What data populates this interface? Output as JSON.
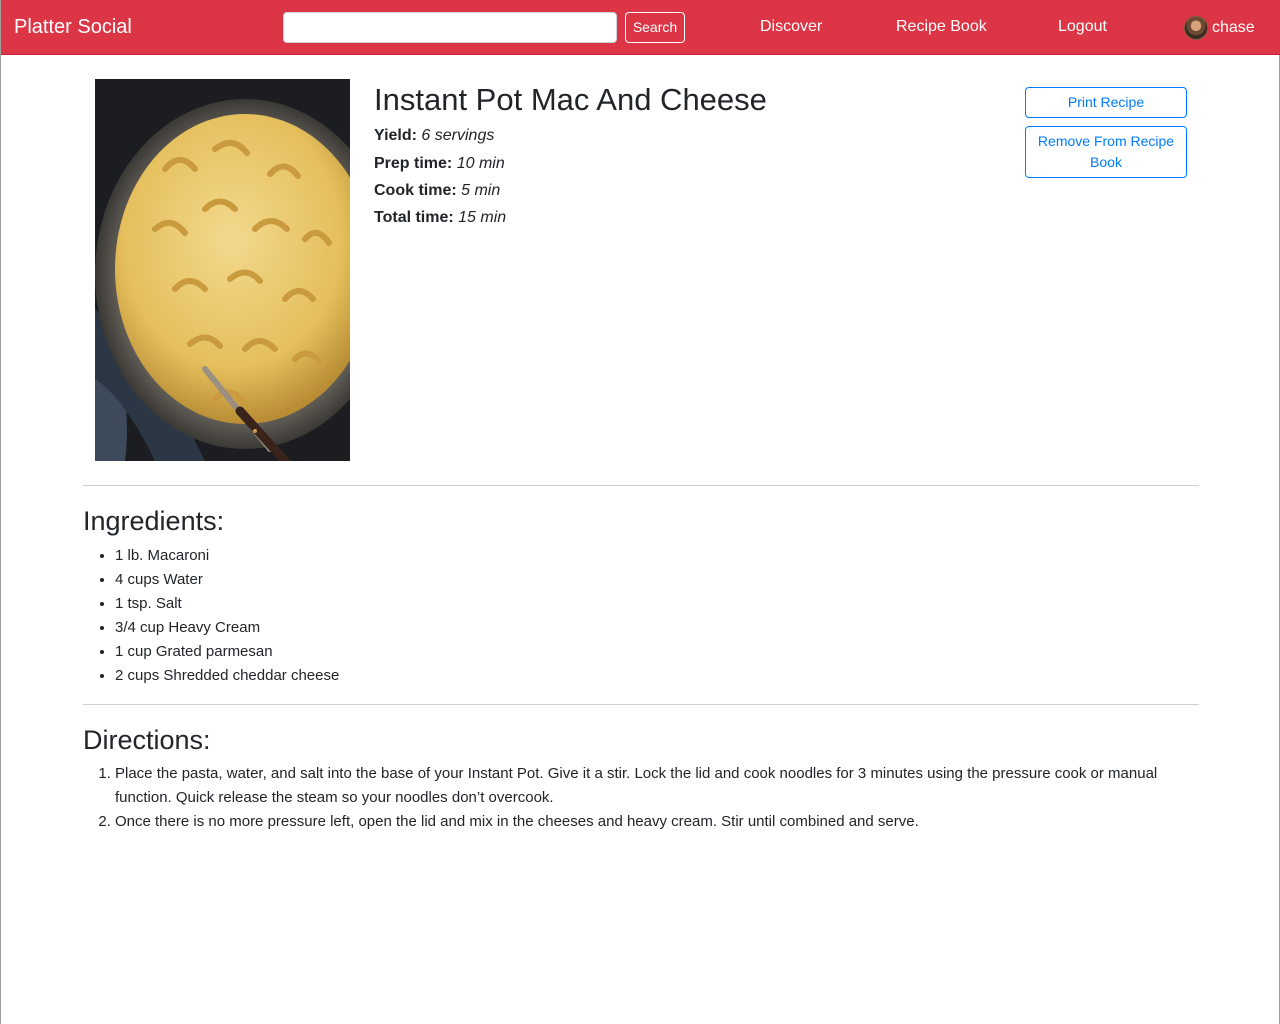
{
  "navbar": {
    "brand": "Platter Social",
    "search_value": "",
    "search_button": "Search",
    "links": [
      "Discover",
      "Recipe Book",
      "Logout"
    ],
    "user": {
      "name": "chase",
      "avatar_icon": "user-avatar"
    },
    "color": "#dc3545"
  },
  "recipe": {
    "title": "Instant Pot Mac And Cheese",
    "image_icon": "mac-and-cheese-photo",
    "yield_label": "Yield:",
    "yield_value": "6 servings",
    "prep_label": "Prep time:",
    "prep_value": "10 min",
    "cook_label": "Cook time:",
    "cook_value": "5 min",
    "total_label": "Total time:",
    "total_value": "15 min"
  },
  "actions": {
    "print": "Print Recipe",
    "remove": "Remove From Recipe Book",
    "color": "#007bff"
  },
  "ingredients": {
    "title": "Ingredients:",
    "items": [
      "1 lb. Macaroni",
      "4 cups Water",
      "1 tsp. Salt",
      "3/4 cup Heavy Cream",
      "1 cup Grated parmesan",
      "2 cups Shredded cheddar cheese"
    ]
  },
  "directions": {
    "title": "Directions:",
    "steps": [
      "Place the pasta, water, and salt into the base of your Instant Pot. Give it a stir. Lock the lid and cook noodles for 3 minutes using the pressure cook or manual function. Quick release the steam so your noodles don’t overcook.",
      "Once there is no more pressure left, open the lid and mix in the cheeses and heavy cream. Stir until combined and serve."
    ]
  }
}
